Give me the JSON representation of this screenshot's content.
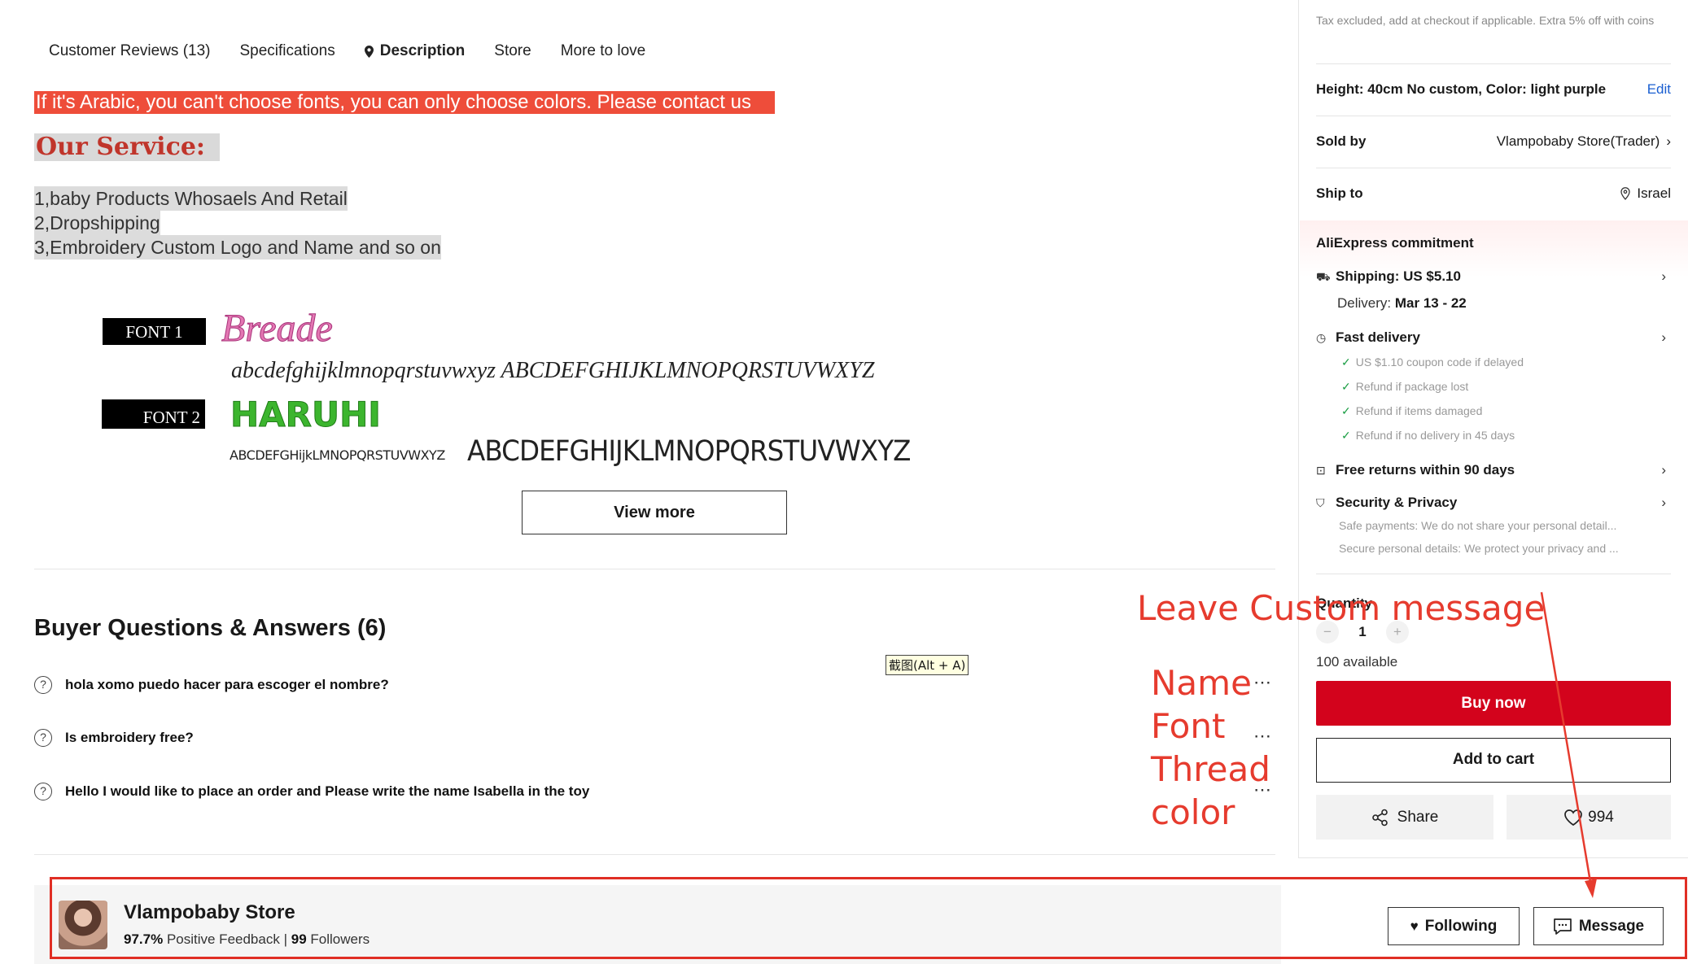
{
  "tabs": [
    {
      "label": "Customer Reviews (13)"
    },
    {
      "label": "Specifications"
    },
    {
      "label": "Description",
      "active": true
    },
    {
      "label": "Store"
    },
    {
      "label": "More to love"
    }
  ],
  "description": {
    "banner": "If it's Arabic, you can't choose fonts, you can only choose colors. Please contact us",
    "service_title": "Our Service:",
    "service_items": [
      "1,baby Products Whosaels And Retail",
      "2,Dropshipping",
      "3,Embroidery Custom Logo and Name and so on"
    ],
    "fonts": [
      {
        "label": "FONT 1",
        "sample": "Breade",
        "alphabet": "abcdefghijklmnopqrstuvwxyz ABCDEFGHIJKLMNOPQRSTUVWXYZ"
      },
      {
        "label": "FONT 2",
        "sample": "HARUHI",
        "alphabet_lower": "ABCDEFGHijkLMNOPQRSTUVWXYZ",
        "alphabet_upper": "ABCDEFGHIJKLMNOPQRSTUVWXYZ"
      }
    ],
    "view_more": "View more"
  },
  "qa": {
    "title": "Buyer Questions & Answers (6)",
    "questions": [
      "hola xomo puedo hacer para escoger el nombre?",
      "Is embroidery free?",
      "Hello I would like to place an order and Please write the name Isabella in the toy"
    ],
    "more_icon": "⋯"
  },
  "tooltip": "截图(Alt + A)",
  "annotations": {
    "leave_message": "Leave Custom message",
    "lines": [
      "Name",
      "Font",
      "Thread",
      "color"
    ]
  },
  "side": {
    "tax_note": "Tax excluded, add at checkout if applicable. Extra 5% off with coins",
    "variant": "Height: 40cm No custom, Color: light purple",
    "edit": "Edit",
    "sold_by_label": "Sold by",
    "sold_by_value": "Vlampobaby Store(Trader)",
    "ship_to_label": "Ship to",
    "ship_to_value": "Israel",
    "commitment_title": "AliExpress commitment",
    "shipping": "Shipping: US $5.10",
    "delivery_label": "Delivery:",
    "delivery_value": "Mar 13 - 22",
    "fast_delivery": "Fast delivery",
    "fast_items": [
      "US $1.10 coupon code if delayed",
      "Refund if package lost",
      "Refund if items damaged",
      "Refund if no delivery in 45 days"
    ],
    "free_returns": "Free returns within 90 days",
    "security": "Security & Privacy",
    "security_items": [
      "Safe payments: We do not share your personal detail...",
      "Secure personal details: We protect your privacy and ..."
    ],
    "quantity_label": "Quantity",
    "quantity": "1",
    "available": "100 available",
    "buy_now": "Buy now",
    "add_to_cart": "Add to cart",
    "share": "Share",
    "wishlist_count": "994"
  },
  "store": {
    "name": "Vlampobaby Store",
    "feedback_value": "97.7%",
    "feedback_label": "Positive Feedback",
    "separator": "|",
    "followers_value": "99",
    "followers_label": "Followers",
    "following": "Following",
    "message": "Message"
  },
  "colors": {
    "accent_red": "#d3031c",
    "annotation_red": "#e63b2e",
    "link_blue": "#1a5fd1",
    "check_green": "#1c9e45"
  }
}
